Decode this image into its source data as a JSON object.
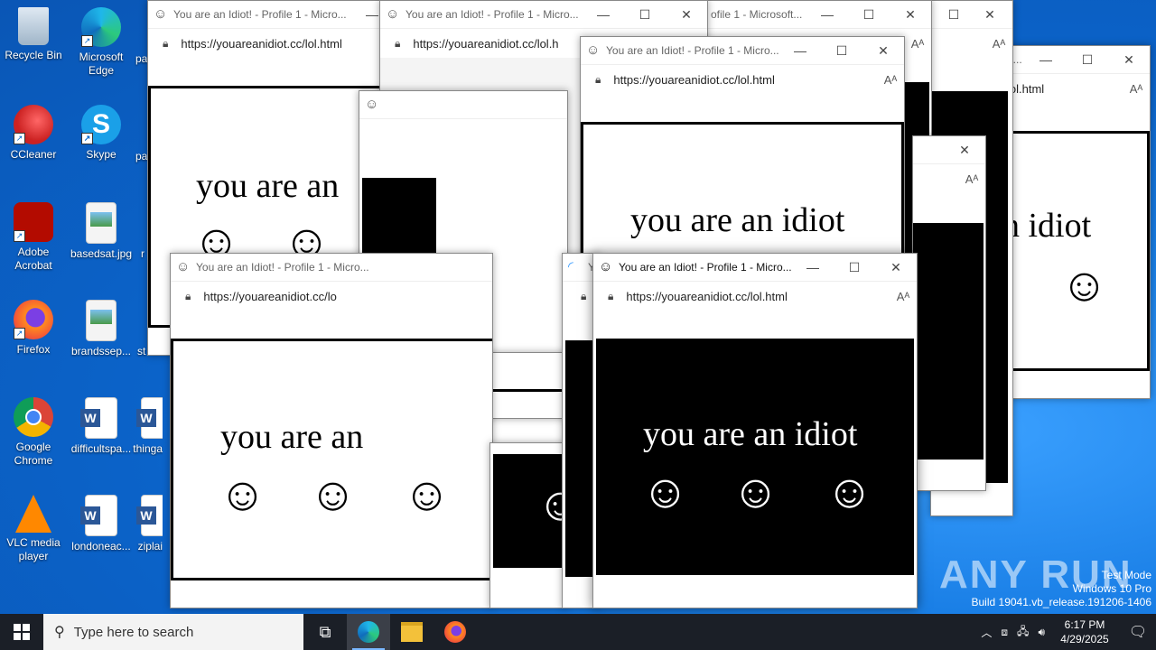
{
  "desktop": {
    "icons": [
      {
        "label": "Recycle Bin"
      },
      {
        "label": "Microsoft Edge"
      },
      {
        "label": "CCleaner"
      },
      {
        "label": "Skype"
      },
      {
        "label": "Adobe Acrobat"
      },
      {
        "label": "basedsat.jpg"
      },
      {
        "label": "Firefox"
      },
      {
        "label": "brandssep..."
      },
      {
        "label": "Google Chrome"
      },
      {
        "label": "difficultspa..."
      },
      {
        "label": "VLC media player"
      },
      {
        "label": "londoneac..."
      },
      {
        "label": "thinga"
      },
      {
        "label": "ziplai"
      }
    ],
    "partial_labels": [
      "pa",
      "pa",
      "r",
      "st"
    ]
  },
  "window": {
    "title_full": "You are an Idiot! - Profile 1 - Micro...",
    "title_alt": "You are an Idiot! - Profile 1 - Micro...",
    "title_partial": "ofile 1 - Microsoft...",
    "title_partial2": "o...",
    "title_partial3": "Yo",
    "url": "https://youareanidiot.cc/lol.html",
    "url_short": "https://youareanidiot.cc/lol.h",
    "url_short2": "https://youareanidiot.cc/lo",
    "url_partial": "lol.html",
    "message": "you are an idiot",
    "message_cut": "you are an",
    "message_cut2": "you are an",
    "message_tail": "n idiot",
    "controls": {
      "minimize": "—",
      "maximize": "☐",
      "close": "✕"
    },
    "smiley": "☺"
  },
  "taskbar": {
    "search_placeholder": "Type here to search",
    "time": "6:17 PM",
    "date": "4/29/2025"
  },
  "watermark": {
    "logo": "ANY RUN",
    "line1": "Test Mode",
    "line2": "Windows 10 Pro",
    "line3": "Build 19041.vb_release.191206-1406"
  }
}
